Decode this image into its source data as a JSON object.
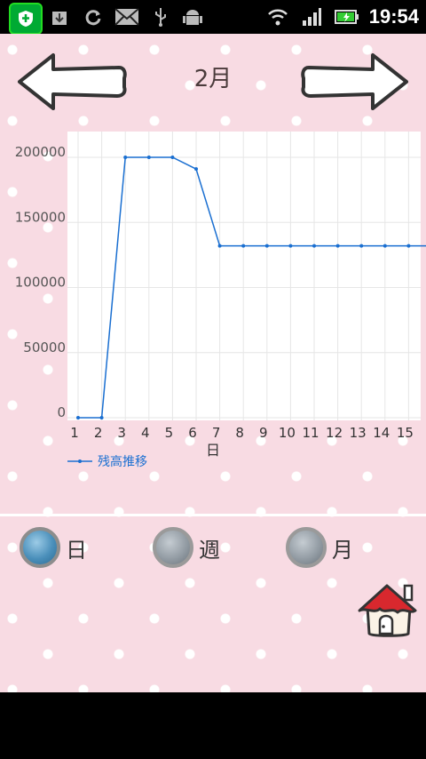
{
  "status_bar": {
    "time": "19:54",
    "icons": [
      "shield-app-icon",
      "download-icon",
      "sync-icon",
      "mail-icon",
      "usb-icon",
      "android-icon",
      "wifi-icon",
      "signal-icon",
      "battery-icon"
    ]
  },
  "header": {
    "month_title": "2月"
  },
  "chart_data": {
    "type": "line",
    "xlabel": "日",
    "ylabel": "",
    "x": [
      1,
      2,
      3,
      4,
      5,
      6,
      7,
      8,
      9,
      10,
      11,
      12,
      13,
      14,
      15,
      16
    ],
    "xticks": [
      "1",
      "2",
      "3",
      "4",
      "5",
      "6",
      "7",
      "8",
      "9",
      "10",
      "11",
      "12",
      "13",
      "14",
      "15"
    ],
    "yticks": [
      "200000",
      "150000",
      "100000",
      "50000",
      "0"
    ],
    "ylim": [
      0,
      210000
    ],
    "series": [
      {
        "name": "残高推移",
        "color": "#1a6fd1",
        "values": [
          0,
          0,
          200000,
          200000,
          200000,
          191000,
          132000,
          132000,
          132000,
          132000,
          132000,
          132000,
          132000,
          132000,
          132000,
          132000
        ]
      }
    ],
    "legend": "bottom-left",
    "grid": true
  },
  "period_options": [
    {
      "label": "日",
      "selected": true
    },
    {
      "label": "週",
      "selected": false
    },
    {
      "label": "月",
      "selected": false
    }
  ],
  "colors": {
    "background": "#f8dbe3",
    "line": "#1a6fd1"
  }
}
